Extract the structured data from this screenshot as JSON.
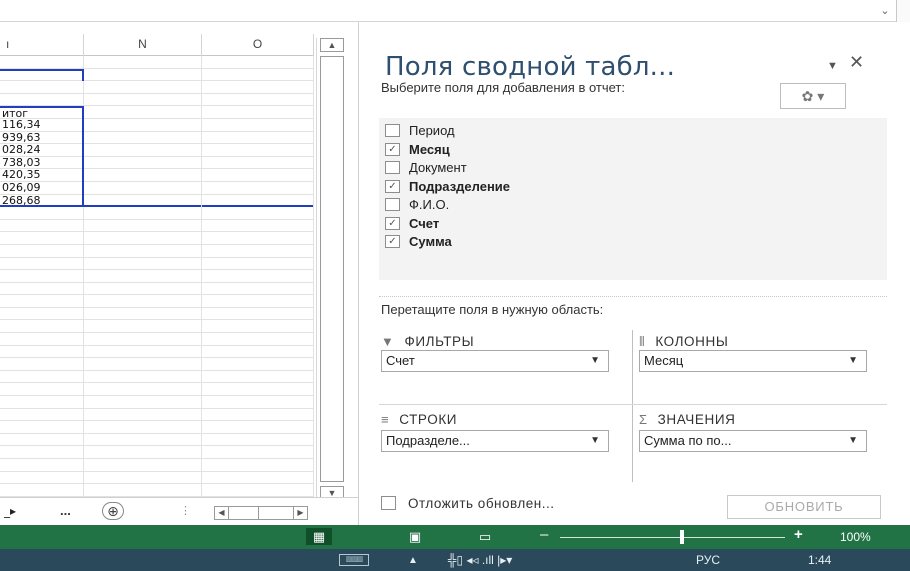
{
  "topbar": {
    "dropdown_glyph": "⌄"
  },
  "grid": {
    "columns": [
      "",
      "N",
      "O"
    ],
    "column_first_partial": "ı",
    "cells": [
      "",
      "",
      "",
      "",
      "итог",
      "116,34",
      "939,63",
      "028,24",
      "738,03",
      "420,35",
      "026,09",
      "268,68"
    ],
    "scroll_up": "▲",
    "scroll_down": "▼"
  },
  "sheetbar": {
    "sheet_tab": "_▸",
    "more": "...",
    "add_sheet": "⊕",
    "separator": "⋮",
    "hscroll_left": "◀",
    "hscroll_right": "▶"
  },
  "pane": {
    "title": "Поля сводной табл...",
    "title_dropdown": "▼",
    "close": "✕",
    "choose_text": "Выберите поля для добавления в отчет:",
    "gear": "✿ ▾",
    "fields": [
      {
        "label": "Период",
        "checked": false
      },
      {
        "label": "Месяц",
        "checked": true
      },
      {
        "label": "Документ",
        "checked": false
      },
      {
        "label": "Подразделение",
        "checked": true
      },
      {
        "label": "Ф.И.О.",
        "checked": false
      },
      {
        "label": "Счет",
        "checked": true
      },
      {
        "label": "Сумма",
        "checked": true
      }
    ],
    "check_glyph": "✓",
    "drag_text": "Перетащите поля в нужную область:",
    "areas": {
      "filters": {
        "icon": "▼",
        "label": "ФИЛЬТРЫ",
        "value": "Счет"
      },
      "columns": {
        "icon": "⦀",
        "label": "КОЛОННЫ",
        "value": "Месяц"
      },
      "rows": {
        "icon": "≡",
        "label": "СТРОКИ",
        "value": "Подразделе..."
      },
      "values": {
        "icon": "Σ",
        "label": "ЗНАЧЕНИЯ",
        "value": "Сумма по по..."
      }
    },
    "area_dropdown": "▼",
    "defer_label": "Отложить обновлен...",
    "update_button": "ОБНОВИТЬ"
  },
  "status": {
    "view_normal": "▦",
    "view_layout": "▣",
    "view_pagebreak": "▭",
    "zoom_minus": "–",
    "zoom_plus": "+",
    "zoom_level": "100%"
  },
  "taskbar": {
    "keyboard": "▥▥▥",
    "up_arrow": "▲",
    "icons": "╬▯  ◂◃  .ıll  |▸▾",
    "language": "РУС",
    "time": "1:44"
  },
  "colors": {
    "status_bar": "#217346",
    "taskbar": "#2a4a5c",
    "selection_border": "#1f3fbf",
    "pane_title": "#2f4f6f"
  }
}
